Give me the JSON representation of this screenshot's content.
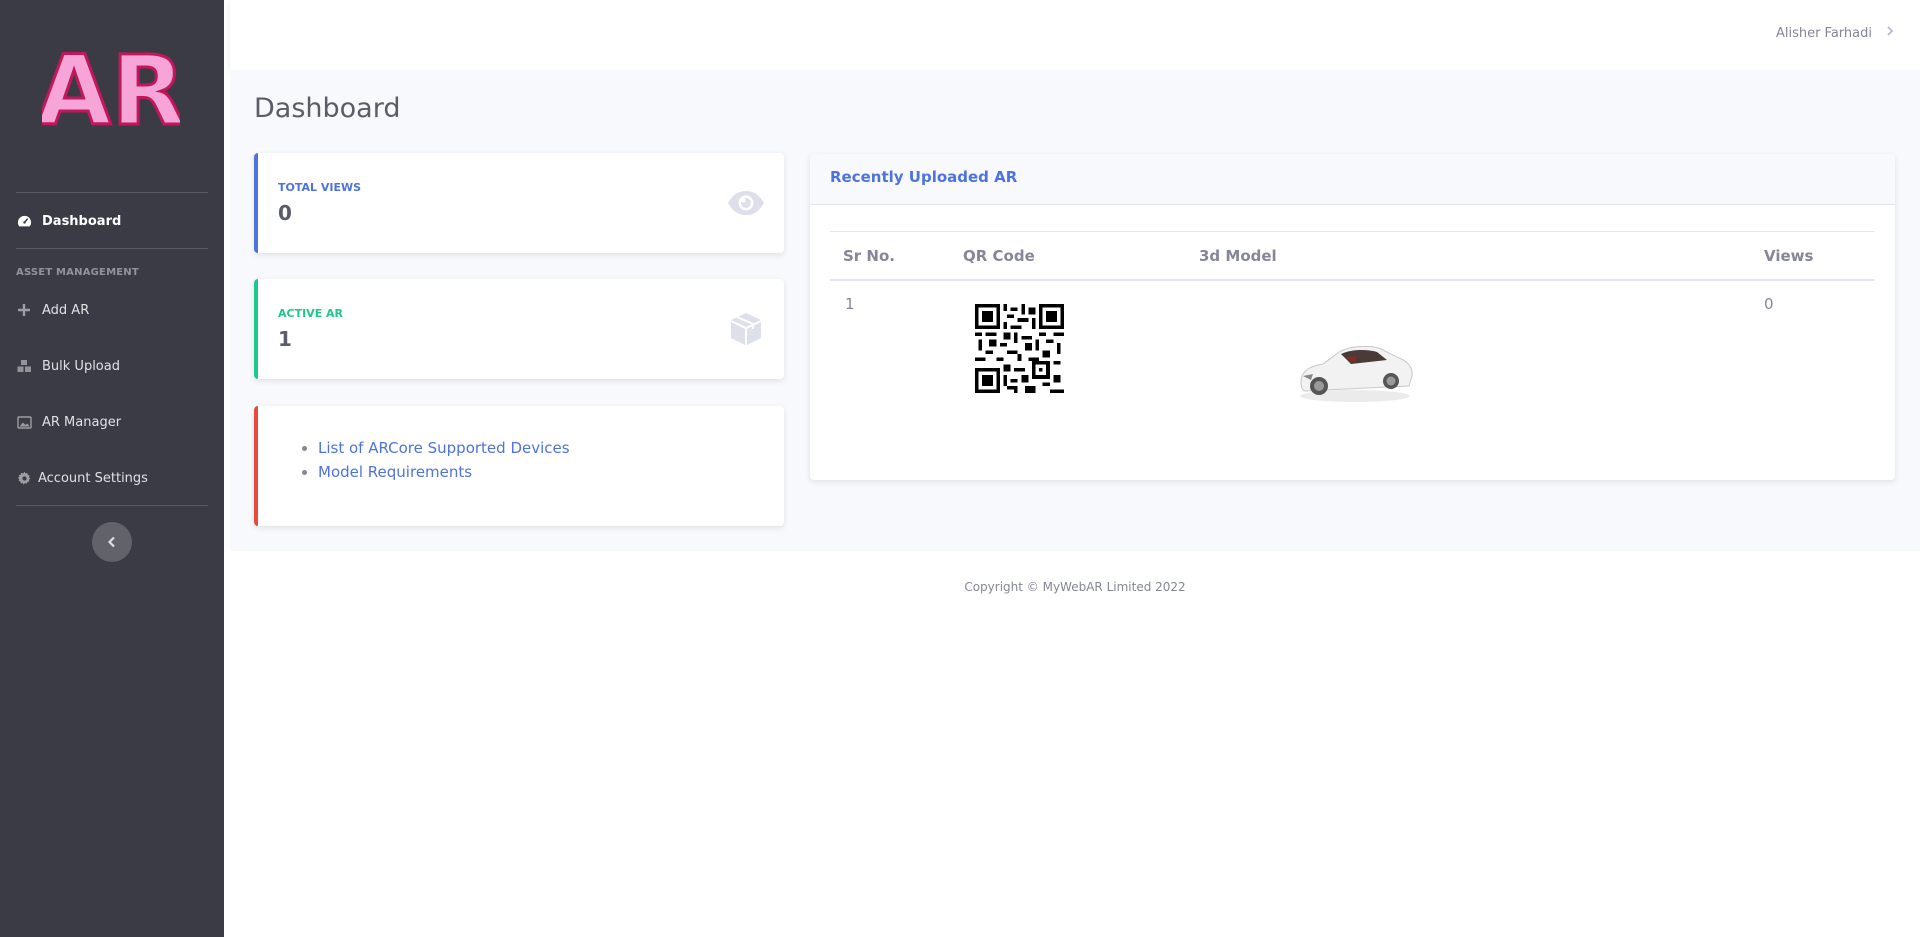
{
  "sidebar": {
    "logo_text": "AR",
    "items": [
      {
        "label": "Dashboard",
        "icon": "dashboard-gauge-icon"
      },
      {
        "label": "Add AR",
        "icon": "plus-icon"
      },
      {
        "label": "Bulk Upload",
        "icon": "boxes-icon"
      },
      {
        "label": "AR Manager",
        "icon": "image-icon"
      },
      {
        "label": "Account Settings",
        "icon": "gear-icon"
      }
    ],
    "section_heading": "ASSET MANAGEMENT",
    "toggle_icon": "chevron-left-icon"
  },
  "topbar": {
    "user_name": "Alisher Farhadi",
    "user_menu_icon": "chevron-right-icon"
  },
  "page": {
    "title": "Dashboard"
  },
  "stats": [
    {
      "label": "TOTAL VIEWS",
      "value": "0",
      "color": "#4e73df",
      "icon": "eye-icon"
    },
    {
      "label": "ACTIVE AR",
      "value": "1",
      "color": "#1cc88a",
      "icon": "cube-icon"
    }
  ],
  "links": [
    {
      "label": "List of ARCore Supported Devices"
    },
    {
      "label": "Model Requirements"
    }
  ],
  "recent": {
    "title": "Recently Uploaded AR",
    "columns": [
      "Sr No.",
      "QR Code",
      "3d Model",
      "Views"
    ],
    "rows": [
      {
        "sr_no": "1",
        "qr_code": "qr-code-image",
        "model": "white-sports-car-3d-model",
        "views": "0"
      }
    ]
  },
  "footer": {
    "copyright": "Copyright © MyWebAR Limited 2022"
  },
  "colors": {
    "primary": "#4e73df",
    "success": "#1cc88a",
    "danger": "#e74a3b",
    "sidebar_bg": "#3a3b45",
    "logo_pink": "#f7a4d9"
  }
}
